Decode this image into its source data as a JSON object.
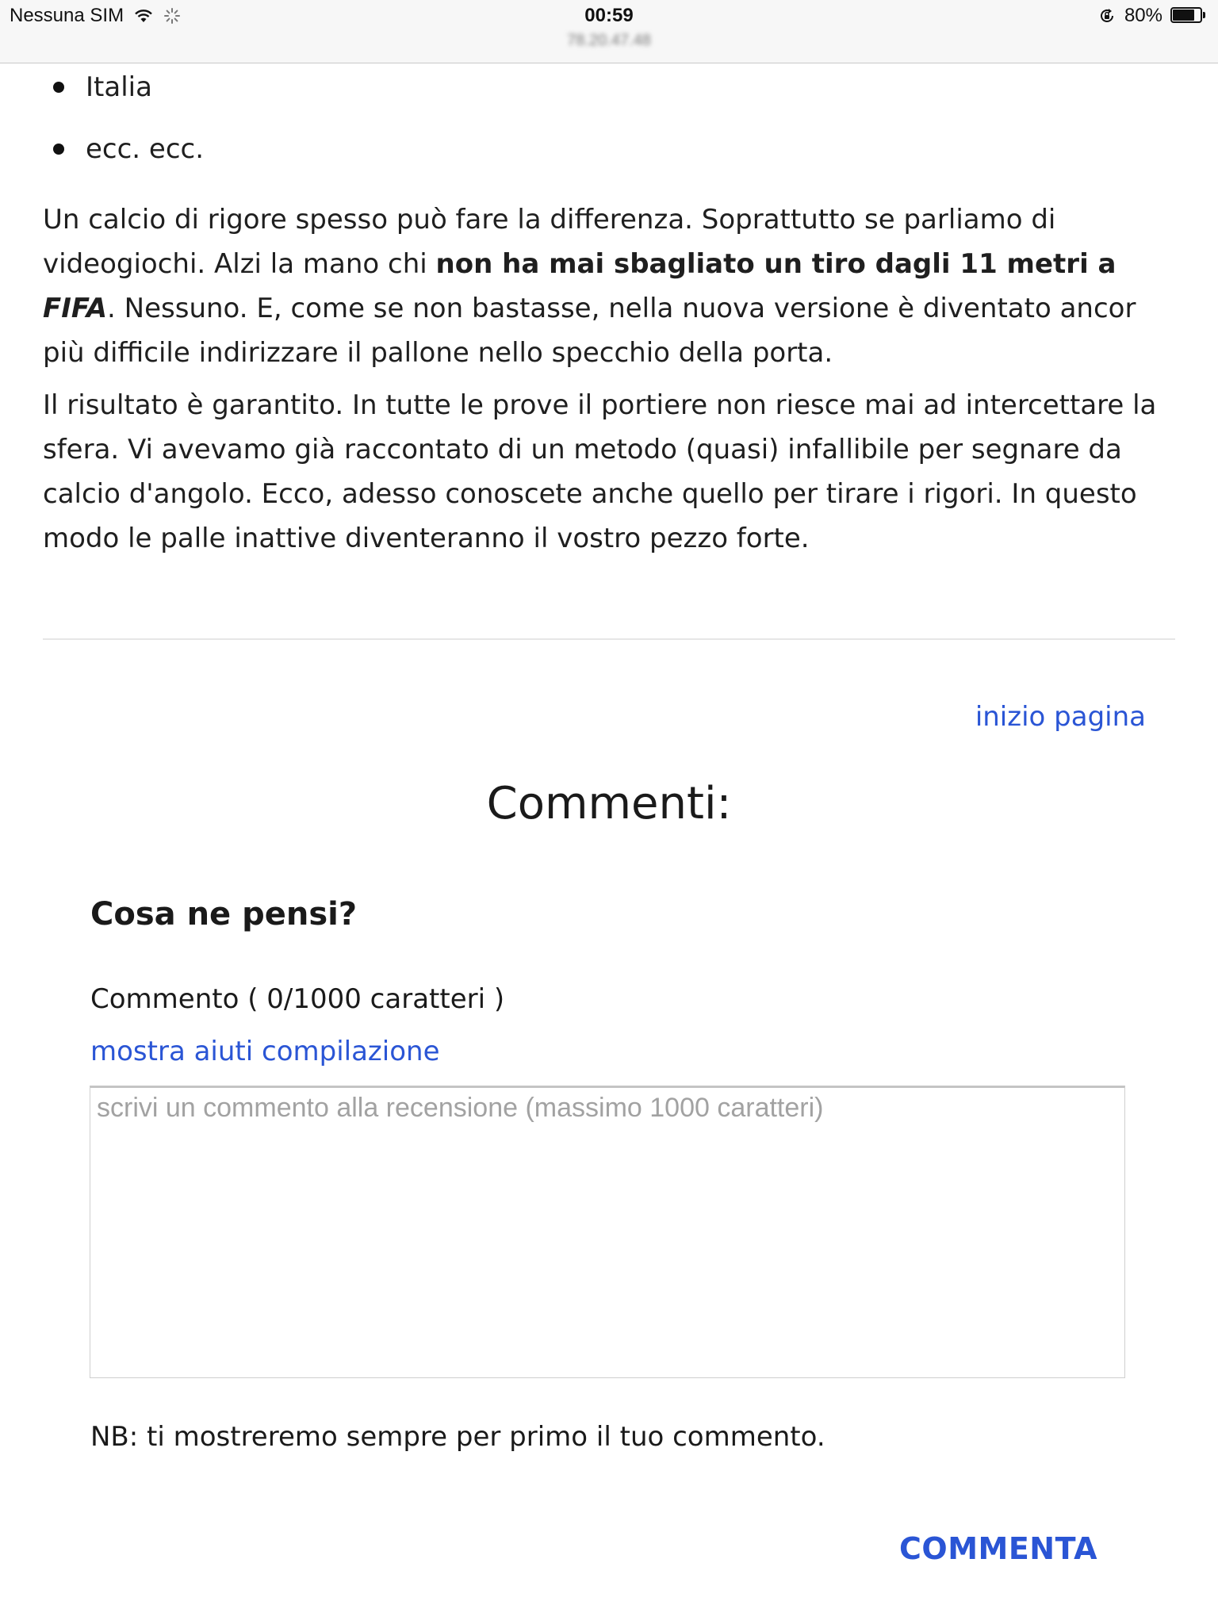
{
  "status_bar": {
    "carrier": "Nessuna SIM",
    "time": "00:59",
    "url": "78.20.47.48",
    "battery": "80%",
    "battery_level": 0.8,
    "icons": [
      "wifi-icon",
      "spinner-icon",
      "rotation-lock-icon",
      "battery-icon"
    ]
  },
  "article": {
    "bullets": [
      "Italia",
      "ecc. ecc."
    ],
    "p1": {
      "a": "Un calcio di rigore spesso può fare la differenza. Soprattutto se parliamo di videogiochi. Alzi la mano chi ",
      "bold": "non ha mai sbagliato un tiro dagli 11 metri a ",
      "bold_italic": "FIFA",
      "b": ". Nessuno. E, come se non bastasse, nella nuova versione è diventato ancor più difficile indirizzare il pallone nello specchio della porta."
    },
    "p2": "Il risultato è garantito. In tutte le prove il portiere non riesce mai ad intercettare la sfera. Vi avevamo già raccontato di un metodo (quasi) infallibile per segnare da calcio d'angolo. Ecco, adesso conoscete anche quello per tirare i rigori. In questo modo le palle inattive diventeranno il vostro pezzo forte."
  },
  "nav": {
    "top_link": "inizio pagina"
  },
  "comments": {
    "heading": "Commenti:",
    "question": "Cosa ne pensi?",
    "label": "Commento ( 0/1000 caratteri )",
    "help_link": "mostra aiuti compilazione",
    "placeholder": "scrivi un commento alla recensione (massimo 1000 caratteri)",
    "value": "",
    "note": "NB: ti mostreremo sempre per primo il tuo commento.",
    "submit_label": "COMMENTA"
  },
  "colors": {
    "link": "#2a55d5",
    "text": "#1f1f1f",
    "status_bar_bg": "#f7f7f7"
  }
}
